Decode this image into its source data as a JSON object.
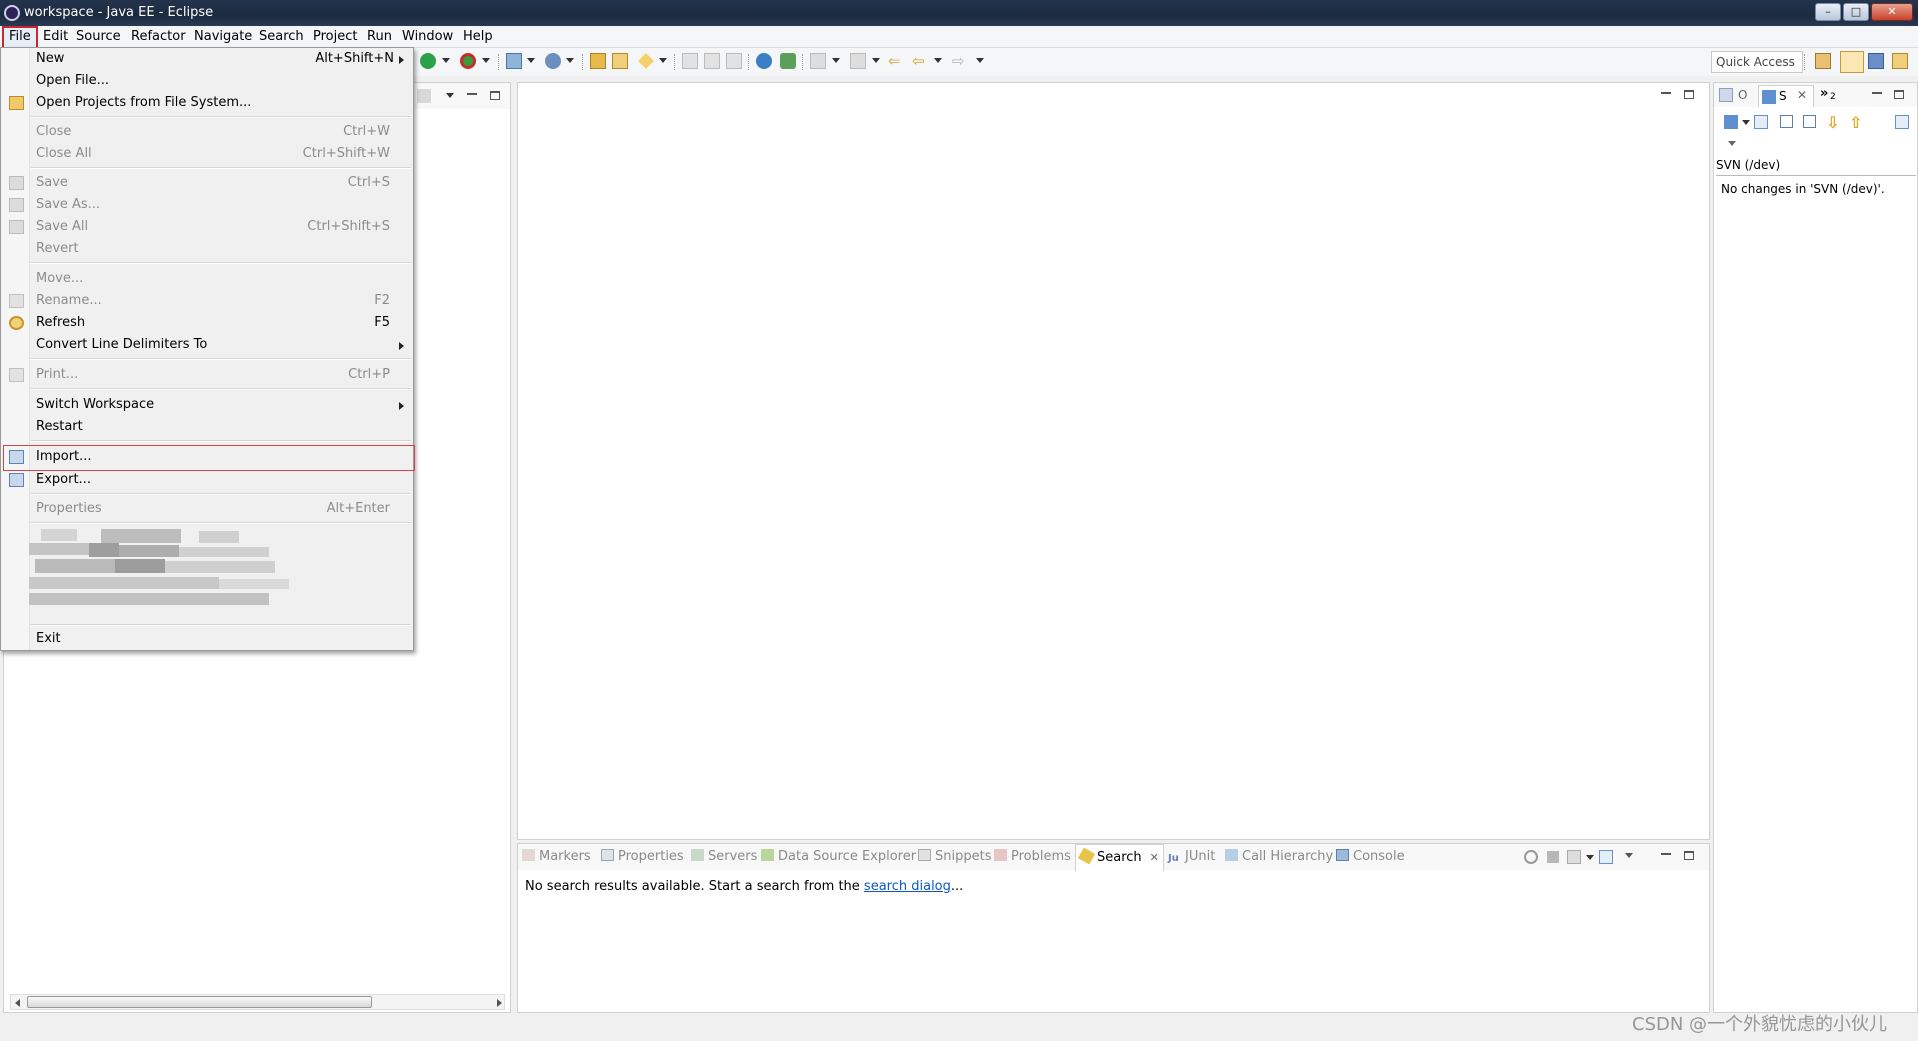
{
  "window": {
    "title": "workspace - Java EE - Eclipse"
  },
  "menubar": [
    "File",
    "Edit",
    "Source",
    "Refactor",
    "Navigate",
    "Search",
    "Project",
    "Run",
    "Window",
    "Help"
  ],
  "toolbar": {
    "quick_access": "Quick Access"
  },
  "file_menu": {
    "items": [
      {
        "label": "New",
        "accel": "Alt+Shift+N",
        "enabled": true,
        "submenu": true
      },
      {
        "label": "Open File...",
        "accel": "",
        "enabled": true
      },
      {
        "label": "Open Projects from File System...",
        "accel": "",
        "enabled": true,
        "icon": "folder-icon"
      },
      {
        "label": "Close",
        "accel": "Ctrl+W",
        "enabled": false
      },
      {
        "label": "Close All",
        "accel": "Ctrl+Shift+W",
        "enabled": false
      },
      {
        "label": "Save",
        "accel": "Ctrl+S",
        "enabled": false,
        "icon": "save-icon"
      },
      {
        "label": "Save As...",
        "accel": "",
        "enabled": false,
        "icon": "save-as-icon"
      },
      {
        "label": "Save All",
        "accel": "Ctrl+Shift+S",
        "enabled": false,
        "icon": "save-all-icon"
      },
      {
        "label": "Revert",
        "accel": "",
        "enabled": false
      },
      {
        "label": "Move...",
        "accel": "",
        "enabled": false
      },
      {
        "label": "Rename...",
        "accel": "F2",
        "enabled": false,
        "icon": "rename-icon"
      },
      {
        "label": "Refresh",
        "accel": "F5",
        "enabled": true,
        "icon": "refresh-icon"
      },
      {
        "label": "Convert Line Delimiters To",
        "accel": "",
        "enabled": true,
        "submenu": true
      },
      {
        "label": "Print...",
        "accel": "Ctrl+P",
        "enabled": false,
        "icon": "print-icon"
      },
      {
        "label": "Switch Workspace",
        "accel": "",
        "enabled": true,
        "submenu": true
      },
      {
        "label": "Restart",
        "accel": "",
        "enabled": true
      },
      {
        "label": "Import...",
        "accel": "",
        "enabled": true,
        "icon": "import-icon",
        "highlighted": true
      },
      {
        "label": "Export...",
        "accel": "",
        "enabled": true,
        "icon": "export-icon"
      },
      {
        "label": "Properties",
        "accel": "Alt+Enter",
        "enabled": false
      },
      {
        "label": "Exit",
        "accel": "",
        "enabled": true
      }
    ]
  },
  "right_panel": {
    "tabs": [
      "O",
      "S"
    ],
    "overflow_count": "2",
    "svn_label": "SVN (/dev)",
    "svn_message": "No changes in 'SVN (/dev)'."
  },
  "bottom_panel": {
    "tabs": [
      {
        "label": "Markers",
        "icon": "markers-icon"
      },
      {
        "label": "Properties",
        "icon": "properties-icon"
      },
      {
        "label": "Servers",
        "icon": "servers-icon"
      },
      {
        "label": "Data Source Explorer",
        "icon": "datasource-icon"
      },
      {
        "label": "Snippets",
        "icon": "snippets-icon"
      },
      {
        "label": "Problems",
        "icon": "problems-icon"
      },
      {
        "label": "Search",
        "icon": "search-icon",
        "active": true
      },
      {
        "label": "JUnit",
        "icon": "junit-icon"
      },
      {
        "label": "Call Hierarchy",
        "icon": "call-hierarchy-icon"
      },
      {
        "label": "Console",
        "icon": "console-icon"
      }
    ],
    "search_message_prefix": "No search results available. Start a search from the ",
    "search_link": "search dialog",
    "search_message_suffix": "..."
  },
  "watermark": "CSDN @一个外貌忧虑的小伙儿",
  "colors": {
    "highlight_border": "#d8434b",
    "link": "#0b57c2",
    "title_bar": "#1b2a3f"
  }
}
